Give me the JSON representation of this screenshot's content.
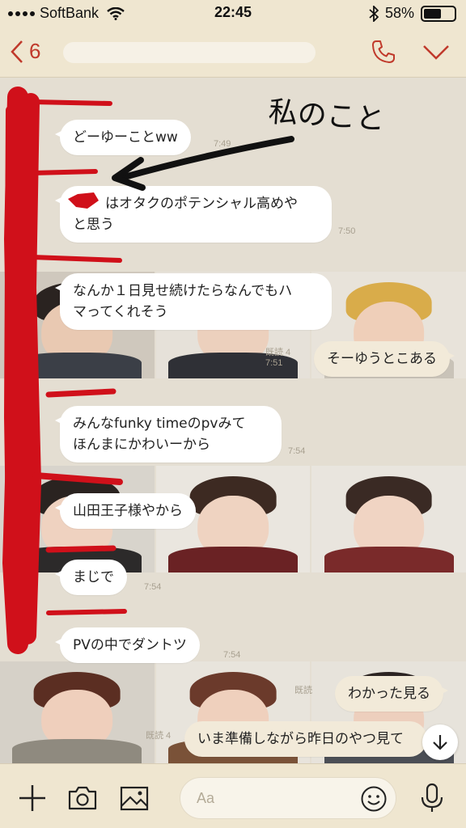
{
  "status_bar": {
    "carrier": "SoftBank",
    "time": "22:45",
    "battery": "58%",
    "battery_level": 0.58
  },
  "header": {
    "back_count": "6"
  },
  "annotation": {
    "text": "私のこと"
  },
  "messages": [
    {
      "side": "left",
      "text": "どーゆーことww",
      "time": "7:49"
    },
    {
      "side": "left",
      "text": "はオタクのポテンシャル高めやと思う",
      "line1": "はオタクのポテンシャル高めや",
      "line2": "と思う",
      "time": "7:50"
    },
    {
      "side": "left",
      "line1": "なんか１日見せ続けたらなんでもハ",
      "line2": "マってくれそう"
    },
    {
      "side": "right",
      "text": "そーゆうとこある",
      "read": "既読 4",
      "time": "7:51"
    },
    {
      "side": "left",
      "line1": "みんなfunky timeのpvみて",
      "line2": "ほんまにかわいーから",
      "time": "7:54"
    },
    {
      "side": "left",
      "text": "山田王子様やから"
    },
    {
      "side": "left",
      "text": "まじで",
      "time": "7:54"
    },
    {
      "side": "left",
      "text": "PVの中でダントツ",
      "time": "7:54"
    },
    {
      "side": "right",
      "text": "わかった見る",
      "read": "既読"
    },
    {
      "side": "right",
      "text": "いま準備しながら昨日のやつ見て",
      "read": "既読 4"
    }
  ],
  "input": {
    "placeholder": "Aa"
  },
  "colors": {
    "header_bg": "#efe6d0",
    "chat_bg": "#e4ded2",
    "accent": "#c0392b",
    "scribble_red": "#d0101a"
  },
  "icons": [
    "back-chevron-icon",
    "phone-icon",
    "chevron-down-icon",
    "plus-icon",
    "camera-icon",
    "image-icon",
    "emoji-icon",
    "microphone-icon",
    "arrow-down-icon",
    "wifi-icon",
    "bluetooth-icon"
  ]
}
